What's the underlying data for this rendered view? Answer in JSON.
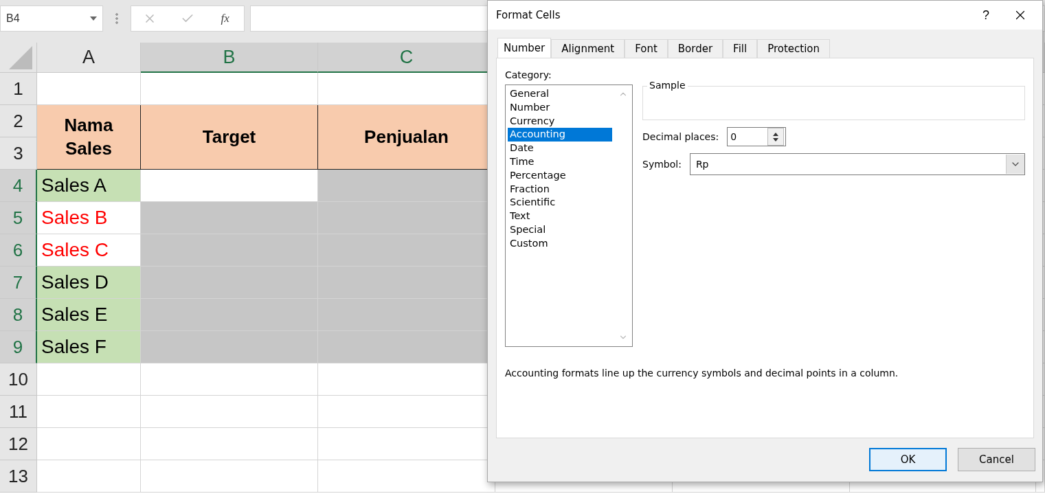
{
  "name_box": {
    "value": "B4"
  },
  "formula_bar": {
    "function_label": "fx"
  },
  "sheet": {
    "columns": [
      {
        "label": "A",
        "selected": false
      },
      {
        "label": "B",
        "selected": true
      },
      {
        "label": "C",
        "selected": true
      }
    ],
    "rows": [
      {
        "label": "1",
        "selected": false
      },
      {
        "label": "2",
        "selected": false,
        "cells": [
          {
            "text": "Nama Sales",
            "kind": "header"
          },
          {
            "text": "Target",
            "kind": "header"
          },
          {
            "text": "Penjualan",
            "kind": "header"
          }
        ]
      },
      {
        "label": "3",
        "selected": false
      },
      {
        "label": "4",
        "selected": true,
        "cells": [
          {
            "text": "Sales A",
            "kind": "name",
            "flagged": false
          },
          {
            "kind": "value",
            "selected": false
          },
          {
            "kind": "value",
            "selected": true
          }
        ]
      },
      {
        "label": "5",
        "selected": true,
        "cells": [
          {
            "text": "Sales B",
            "kind": "name",
            "flagged": true
          },
          {
            "kind": "value",
            "selected": true
          },
          {
            "kind": "value",
            "selected": true
          }
        ]
      },
      {
        "label": "6",
        "selected": true,
        "cells": [
          {
            "text": "Sales C",
            "kind": "name",
            "flagged": true
          },
          {
            "kind": "value",
            "selected": true
          },
          {
            "kind": "value",
            "selected": true
          }
        ]
      },
      {
        "label": "7",
        "selected": true,
        "cells": [
          {
            "text": "Sales D",
            "kind": "name",
            "flagged": false
          },
          {
            "kind": "value",
            "selected": true
          },
          {
            "kind": "value",
            "selected": true
          }
        ]
      },
      {
        "label": "8",
        "selected": true,
        "cells": [
          {
            "text": "Sales E",
            "kind": "name",
            "flagged": false
          },
          {
            "kind": "value",
            "selected": true
          },
          {
            "kind": "value",
            "selected": true
          }
        ]
      },
      {
        "label": "9",
        "selected": true,
        "cells": [
          {
            "text": "Sales F",
            "kind": "name",
            "flagged": false
          },
          {
            "kind": "value",
            "selected": true
          },
          {
            "kind": "value",
            "selected": true
          }
        ]
      },
      {
        "label": "10",
        "selected": false
      },
      {
        "label": "11",
        "selected": false
      },
      {
        "label": "12",
        "selected": false
      },
      {
        "label": "13",
        "selected": false
      }
    ]
  },
  "dialog": {
    "title": "Format Cells",
    "help": "?",
    "tabs": [
      {
        "label": "Number",
        "selected": true
      },
      {
        "label": "Alignment",
        "selected": false
      },
      {
        "label": "Font",
        "selected": false
      },
      {
        "label": "Border",
        "selected": false
      },
      {
        "label": "Fill",
        "selected": false
      },
      {
        "label": "Protection",
        "selected": false
      }
    ],
    "category_label": "Category:",
    "categories": [
      {
        "label": "General",
        "selected": false
      },
      {
        "label": "Number",
        "selected": false
      },
      {
        "label": "Currency",
        "selected": false
      },
      {
        "label": "Accounting",
        "selected": true
      },
      {
        "label": "Date",
        "selected": false
      },
      {
        "label": "Time",
        "selected": false
      },
      {
        "label": "Percentage",
        "selected": false
      },
      {
        "label": "Fraction",
        "selected": false
      },
      {
        "label": "Scientific",
        "selected": false
      },
      {
        "label": "Text",
        "selected": false
      },
      {
        "label": "Special",
        "selected": false
      },
      {
        "label": "Custom",
        "selected": false
      }
    ],
    "sample_label": "Sample",
    "decimal_label": "Decimal places:",
    "decimal_value": "0",
    "symbol_label": "Symbol:",
    "symbol_value": "Rp",
    "description": "Accounting formats line up the currency symbols and decimal points in a column.",
    "buttons": [
      {
        "label": "OK",
        "kind": "default"
      },
      {
        "label": "Cancel",
        "kind": "normal"
      }
    ]
  }
}
